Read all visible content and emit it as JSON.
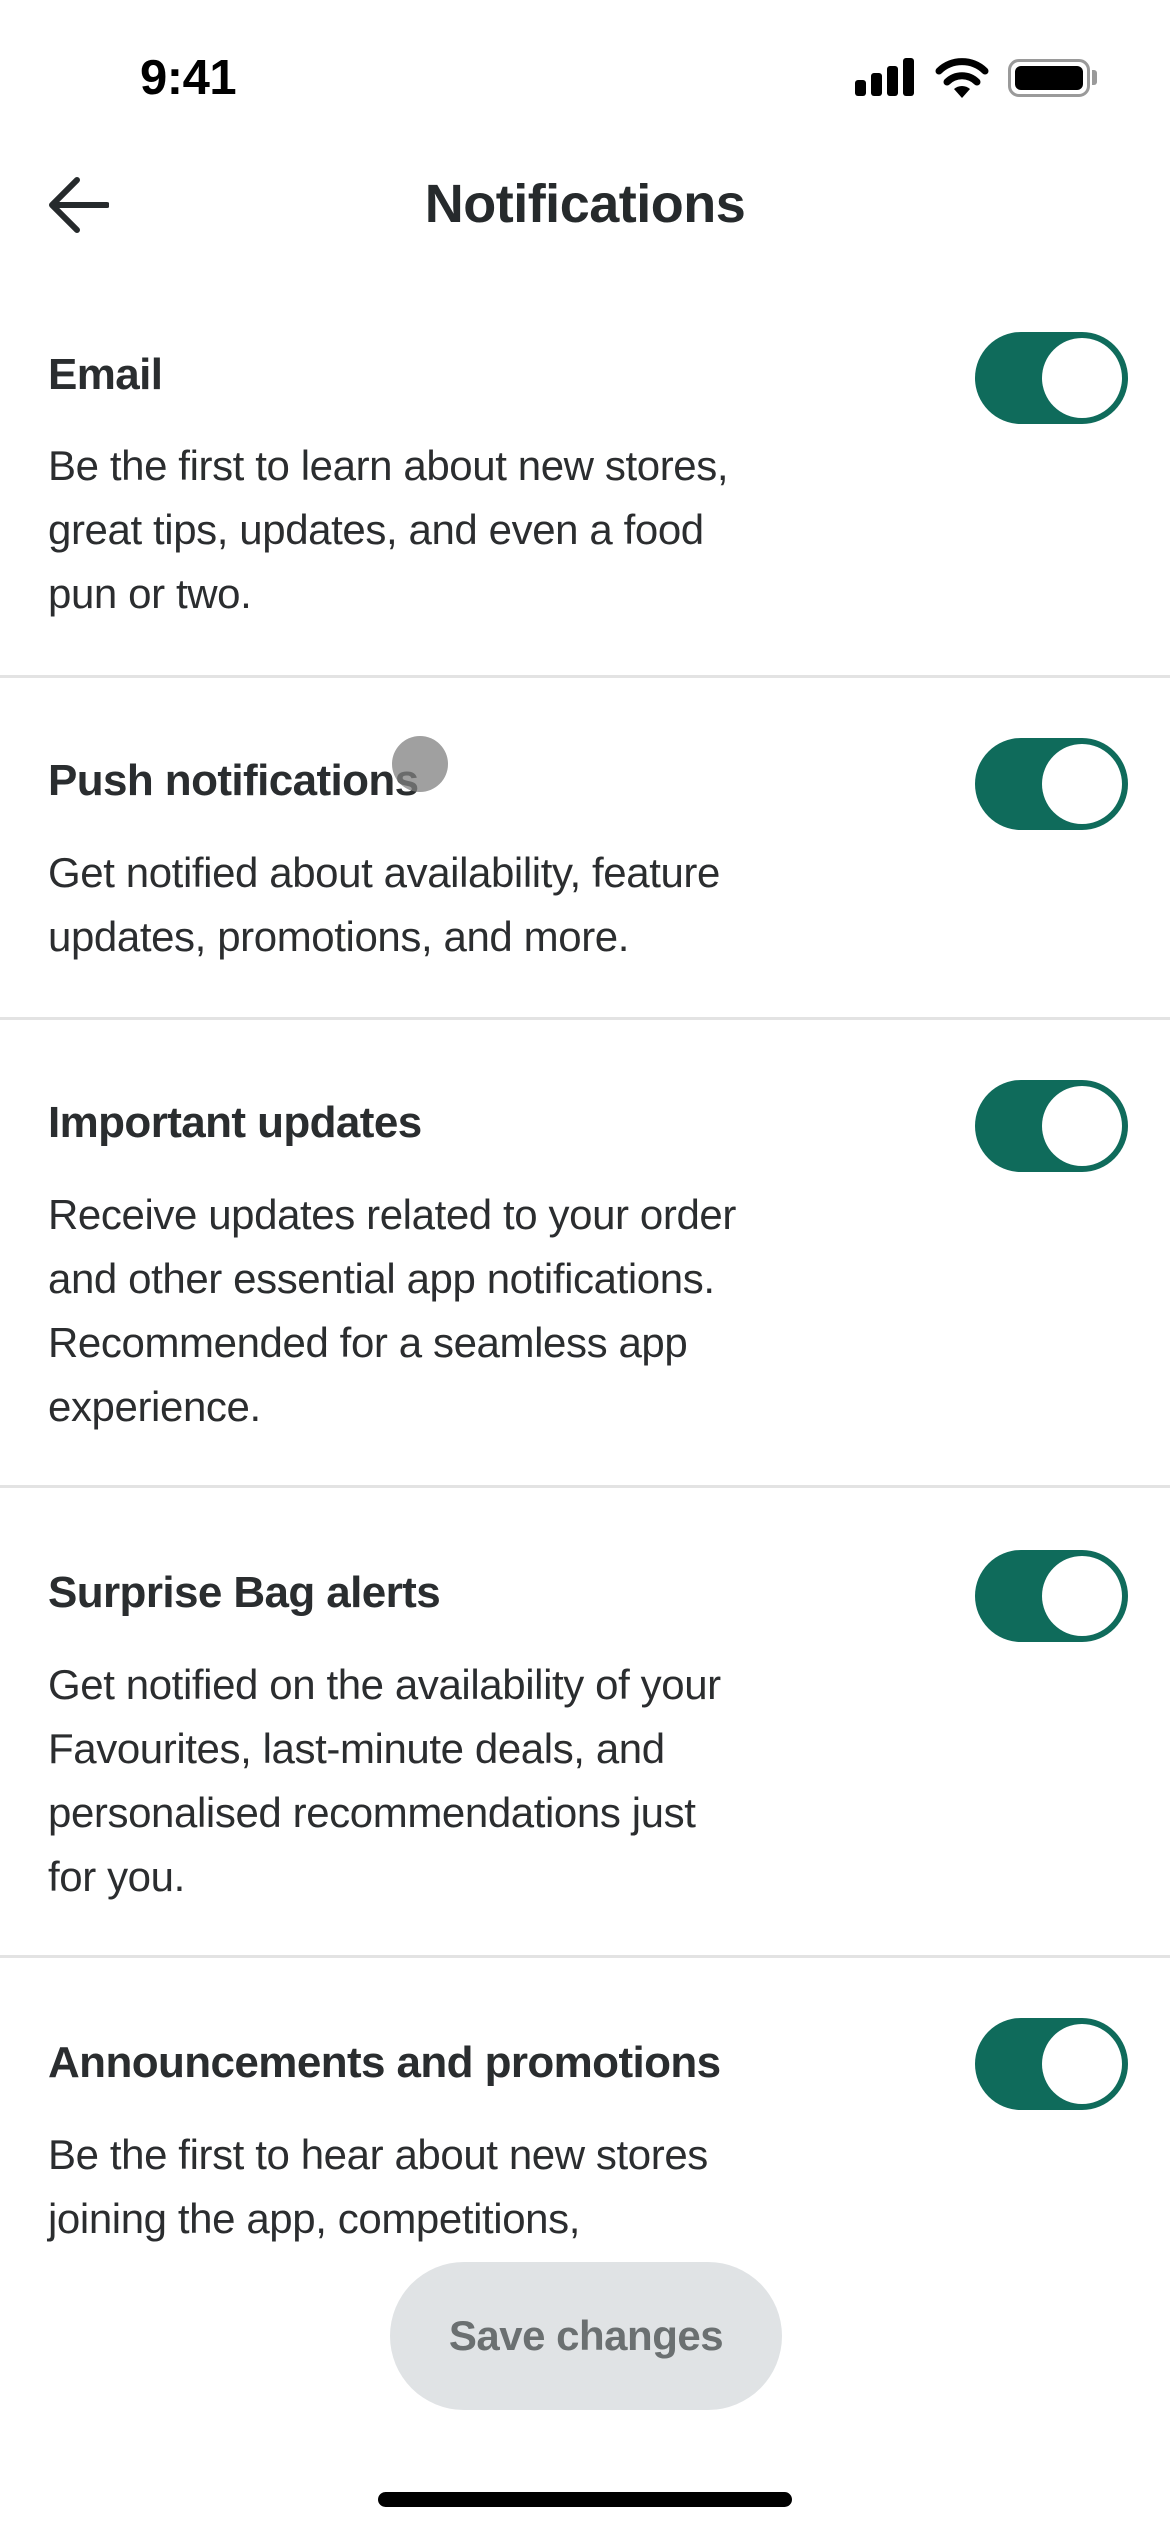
{
  "status_bar": {
    "time": "9:41",
    "icons": [
      "cellular-signal-icon",
      "wifi-icon",
      "battery-icon"
    ]
  },
  "nav": {
    "back_icon": "arrow-left-icon",
    "title": "Notifications"
  },
  "settings": [
    {
      "id": "email",
      "title": "Email",
      "enabled": true,
      "description": "Be the first to learn about new stores, great tips, updates, and even a food pun or two.",
      "lines": [
        "Be the first to learn about new stores,",
        "great tips, updates, and even a food",
        "pun or two."
      ]
    },
    {
      "id": "push-notifications",
      "title": "Push notifications",
      "enabled": true,
      "description": "Get notified about availability, feature updates, promotions, and more.",
      "lines": [
        "Get notified about availability, feature",
        "updates, promotions, and more."
      ]
    },
    {
      "id": "important-updates",
      "title": "Important updates",
      "enabled": true,
      "description": "Receive updates related to your order and other essential app notifications. Recommended for a seamless app experience.",
      "lines": [
        "Receive updates related to your order",
        "and other essential app notifications.",
        "Recommended for a seamless app",
        "experience."
      ]
    },
    {
      "id": "surprise-bag-alerts",
      "title": "Surprise Bag alerts",
      "enabled": true,
      "description": "Get notified on the availability of your Favourites, last-minute deals, and personalised recommendations just for you.",
      "lines": [
        "Get notified on the availability of your",
        "Favourites, last-minute deals, and",
        "personalised recommendations just",
        "for you."
      ]
    },
    {
      "id": "announcements-and-promotions",
      "title": "Announcements and promotions",
      "enabled": true,
      "description": "Be the first to hear about new stores joining the app, competitions, ...",
      "lines": [
        "Be the first to hear about new stores",
        "joining the app, competitions,",
        ""
      ]
    }
  ],
  "footer": {
    "save_label": "Save changes",
    "save_enabled": false
  },
  "colors": {
    "toggle_on": "#0f6b5b",
    "text_primary": "#2a2d2f",
    "button_disabled_bg": "#e0e3e5",
    "button_disabled_text": "#6b7071",
    "divider": "#e3e3e3"
  }
}
